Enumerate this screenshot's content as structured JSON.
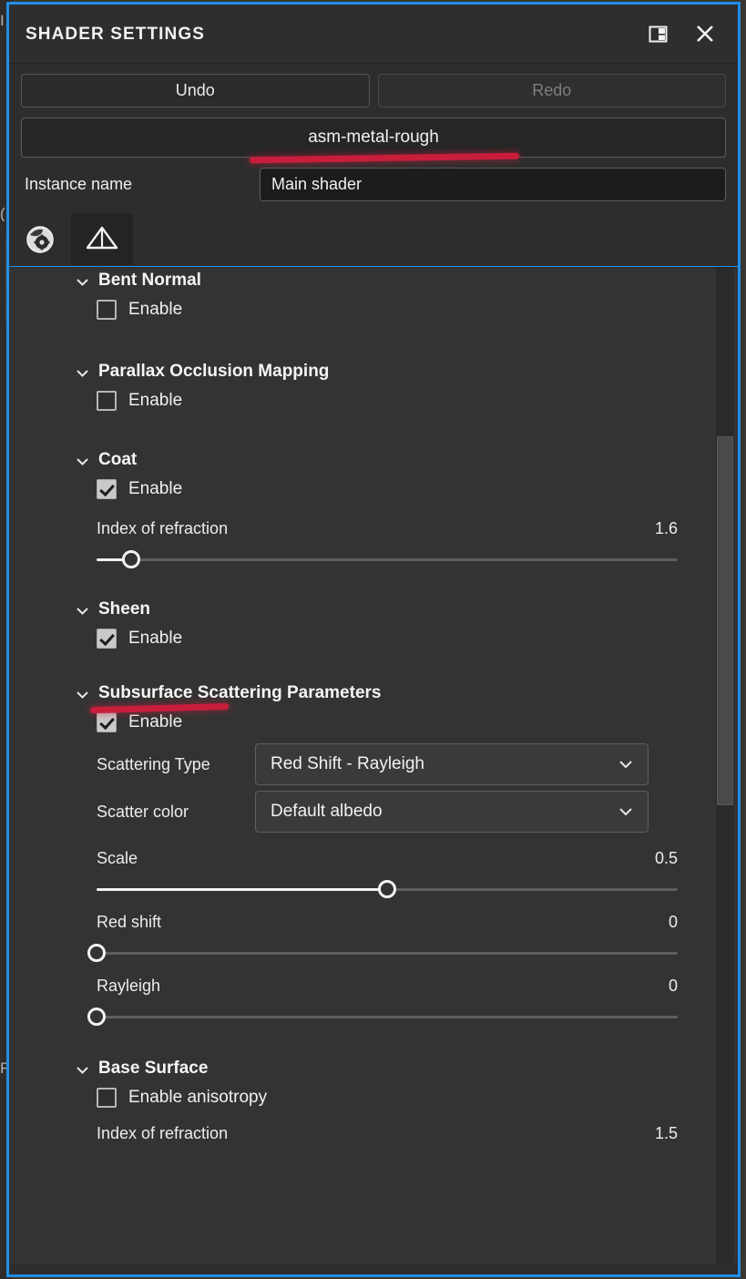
{
  "window": {
    "title": "SHADER SETTINGS",
    "border_color": "#1f8fe8",
    "dock_icon": "dock-panel-icon",
    "close_icon": "close-icon"
  },
  "toolbar": {
    "undo_label": "Undo",
    "redo_label": "Redo",
    "redo_disabled": true,
    "shader_name": "asm-metal-rough"
  },
  "instance": {
    "label": "Instance name",
    "value": "Main shader"
  },
  "tabs": [
    {
      "icon": "material-sphere-gear-icon",
      "active": false
    },
    {
      "icon": "pyramid-wireframe-icon",
      "active": true
    }
  ],
  "sections": [
    {
      "title": "Bent Normal",
      "caret": "chevron-down-icon",
      "enable_label": "Enable",
      "enabled": false
    },
    {
      "title": "Parallax Occlusion Mapping",
      "caret": "chevron-down-icon",
      "enable_label": "Enable",
      "enabled": false
    },
    {
      "title": "Coat",
      "caret": "chevron-down-icon",
      "enable_label": "Enable",
      "enabled": true,
      "params": [
        {
          "name": "Index of refraction",
          "value": "1.6",
          "percent": 6
        }
      ]
    },
    {
      "title": "Sheen",
      "caret": "chevron-down-icon",
      "enable_label": "Enable",
      "enabled": true
    },
    {
      "title": "Subsurface Scattering Parameters",
      "caret": "chevron-down-icon",
      "enable_label": "Enable",
      "enabled": true,
      "dropdowns": [
        {
          "label": "Scattering Type",
          "value": "Red Shift - Rayleigh",
          "icon": "chevron-down-icon"
        },
        {
          "label": "Scatter color",
          "value": "Default albedo",
          "icon": "chevron-down-icon"
        }
      ],
      "params": [
        {
          "name": "Scale",
          "value": "0.5",
          "percent": 50
        },
        {
          "name": "Red shift",
          "value": "0",
          "percent": 0
        },
        {
          "name": "Rayleigh",
          "value": "0",
          "percent": 0
        }
      ]
    },
    {
      "title": "Base Surface",
      "caret": "chevron-down-icon",
      "enable_label": "Enable anisotropy",
      "enabled": false,
      "clipped_param": {
        "name": "Index of refraction",
        "value": "1.5"
      }
    }
  ],
  "scrollbar": {
    "thumb_top_pct": 17,
    "thumb_height_pct": 37
  },
  "annotations": {
    "color": "#c81e3c",
    "strokes": [
      {
        "name": "underline-shader-name"
      },
      {
        "name": "underline-sheen-enable"
      }
    ]
  },
  "backdrop_ghost_text": [
    "I",
    "(",
    "R"
  ]
}
